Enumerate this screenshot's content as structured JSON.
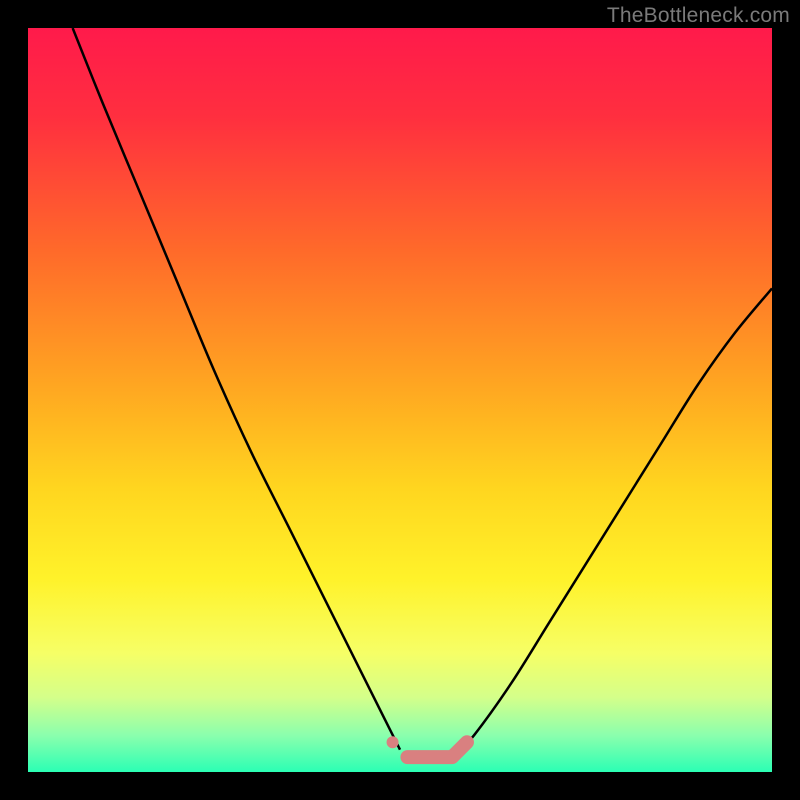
{
  "watermark": "TheBottleneck.com",
  "colors": {
    "gradient_stops": [
      {
        "offset": 0.0,
        "color": "#ff1a4b"
      },
      {
        "offset": 0.12,
        "color": "#ff2f3f"
      },
      {
        "offset": 0.3,
        "color": "#ff6a2a"
      },
      {
        "offset": 0.48,
        "color": "#ffa621"
      },
      {
        "offset": 0.62,
        "color": "#ffd61f"
      },
      {
        "offset": 0.74,
        "color": "#fff22a"
      },
      {
        "offset": 0.84,
        "color": "#f6ff66"
      },
      {
        "offset": 0.9,
        "color": "#d4ff8a"
      },
      {
        "offset": 0.95,
        "color": "#8cffad"
      },
      {
        "offset": 1.0,
        "color": "#2bffb4"
      }
    ],
    "curve": "#000000",
    "marker": "#d98080",
    "background": "#000000"
  },
  "chart_data": {
    "type": "line",
    "title": "",
    "xlabel": "",
    "ylabel": "",
    "xlim": [
      0,
      100
    ],
    "ylim": [
      0,
      100
    ],
    "grid": false,
    "legend": false,
    "series": [
      {
        "name": "left-curve",
        "x": [
          6,
          10,
          15,
          20,
          25,
          30,
          35,
          40,
          45,
          48,
          50
        ],
        "y": [
          100,
          90,
          78,
          66,
          54,
          43,
          33,
          23,
          13,
          7,
          3
        ]
      },
      {
        "name": "right-curve",
        "x": [
          58,
          60,
          65,
          70,
          75,
          80,
          85,
          90,
          95,
          100
        ],
        "y": [
          3,
          5,
          12,
          20,
          28,
          36,
          44,
          52,
          59,
          65
        ]
      },
      {
        "name": "valley-markers",
        "x": [
          49,
          51,
          53,
          55,
          57,
          59
        ],
        "y": [
          4,
          2,
          2,
          2,
          2,
          4
        ]
      }
    ]
  }
}
